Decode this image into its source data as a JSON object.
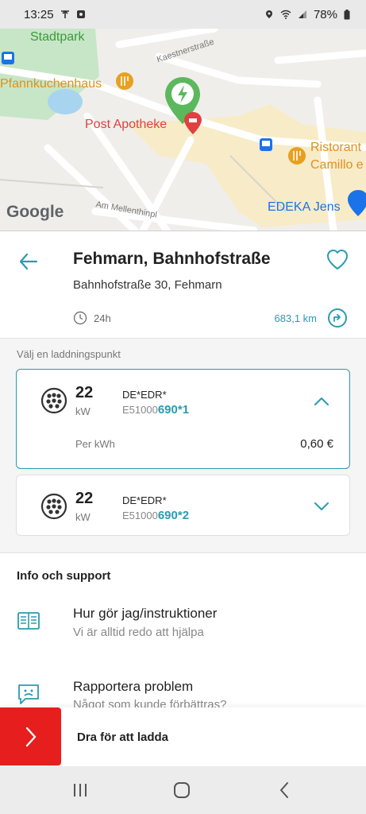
{
  "status_bar": {
    "time": "13:25",
    "battery": "78%",
    "icons": [
      "antenna-icon",
      "screen-record-icon",
      "location-icon",
      "wifi-icon",
      "signal-icon",
      "battery-icon"
    ]
  },
  "map": {
    "labels": {
      "park": "Stadtpark",
      "street_top": "Kaestnerstraße",
      "restaurant_left": "Pfannkuchenhaus",
      "pharmacy": "Post Apotheke",
      "restaurant_right_1": "Ristorant",
      "restaurant_right_2": "Camillo e",
      "street_bottom": "Am Mellenthinpl",
      "store": "EDEKA Jens",
      "logo": "Google"
    },
    "colors": {
      "charger_pin": "#5cb85c",
      "pharmacy": "#e04040",
      "restaurant": "#e8a020",
      "park": "#3a9a3a",
      "store": "#1a73e8"
    }
  },
  "station": {
    "name": "Fehmarn, Bahnhofstraße",
    "address": "Bahnhofstraße 30, Fehmarn",
    "hours": "24h",
    "distance": "683,1 km"
  },
  "charge_points": {
    "label": "Välj en laddningspunkt",
    "items": [
      {
        "power": "22",
        "unit": "kW",
        "evse_prefix": "DE*EDR*",
        "evse_mid": "E51000",
        "evse_suffix": "690*1",
        "price_label": "Per kWh",
        "price": "0,60 €"
      },
      {
        "power": "22",
        "unit": "kW",
        "evse_prefix": "DE*EDR*",
        "evse_mid": "E51000",
        "evse_suffix": "690*2"
      }
    ]
  },
  "info": {
    "title": "Info och support",
    "items": [
      {
        "title": "Hur gör jag/instruktioner",
        "subtitle": "Vi är alltid redo att hjälpa"
      },
      {
        "title": "Rapportera problem",
        "subtitle": "Något som kunde förbättras?"
      }
    ]
  },
  "slide": {
    "label": "Dra för att ladda"
  },
  "colors": {
    "accent": "#2a9bb0",
    "slide": "#e61e1e"
  }
}
